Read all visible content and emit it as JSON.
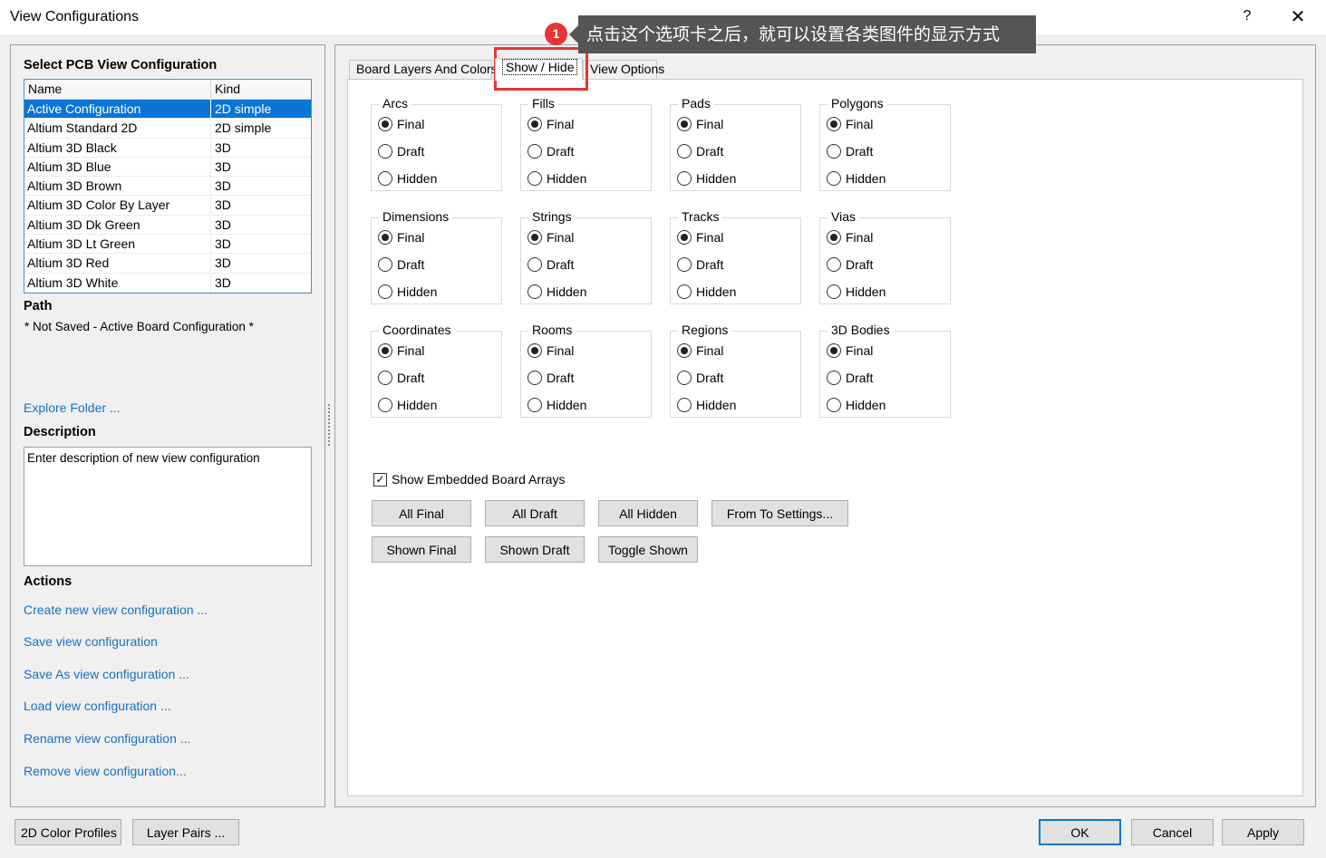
{
  "window": {
    "title": "View Configurations",
    "help": "?",
    "close": "✕"
  },
  "left": {
    "select_heading": "Select PCB View Configuration",
    "columns": [
      "Name",
      "Kind"
    ],
    "rows": [
      {
        "name": "Active Configuration",
        "kind": "2D simple"
      },
      {
        "name": "Altium Standard 2D",
        "kind": "2D simple"
      },
      {
        "name": "Altium 3D Black",
        "kind": "3D"
      },
      {
        "name": "Altium 3D Blue",
        "kind": "3D"
      },
      {
        "name": "Altium 3D Brown",
        "kind": "3D"
      },
      {
        "name": "Altium 3D Color By Layer",
        "kind": "3D"
      },
      {
        "name": "Altium 3D Dk Green",
        "kind": "3D"
      },
      {
        "name": "Altium 3D Lt Green",
        "kind": "3D"
      },
      {
        "name": "Altium 3D Red",
        "kind": "3D"
      },
      {
        "name": "Altium 3D White",
        "kind": "3D"
      }
    ],
    "path_heading": "Path",
    "path_value": "* Not Saved - Active Board Configuration *",
    "explore_folder": "Explore Folder ...",
    "description_heading": "Description",
    "description_value": "Enter description of new view configuration",
    "actions_heading": "Actions",
    "actions": [
      "Create new view configuration ...",
      "Save view configuration",
      "Save As view configuration ...",
      "Load view configuration ...",
      "Rename view configuration ...",
      "Remove view configuration..."
    ]
  },
  "tabs": [
    "Board Layers And Colors",
    "Show / Hide",
    "View Options"
  ],
  "groups": [
    {
      "title": "Arcs",
      "selected": "Final"
    },
    {
      "title": "Fills",
      "selected": "Final"
    },
    {
      "title": "Pads",
      "selected": "Final"
    },
    {
      "title": "Polygons",
      "selected": "Final"
    },
    {
      "title": "Dimensions",
      "selected": "Final"
    },
    {
      "title": "Strings",
      "selected": "Final"
    },
    {
      "title": "Tracks",
      "selected": "Final"
    },
    {
      "title": "Vias",
      "selected": "Final"
    },
    {
      "title": "Coordinates",
      "selected": "Final"
    },
    {
      "title": "Rooms",
      "selected": "Final"
    },
    {
      "title": "Regions",
      "selected": "Final"
    },
    {
      "title": "3D Bodies",
      "selected": "Final"
    }
  ],
  "radio_options": [
    "Final",
    "Draft",
    "Hidden"
  ],
  "embedded_checkbox": {
    "label": "Show Embedded Board Arrays",
    "checked": true
  },
  "buttons": {
    "all_final": "All Final",
    "all_draft": "All Draft",
    "all_hidden": "All Hidden",
    "from_to": "From To Settings...",
    "shown_final": "Shown Final",
    "shown_draft": "Shown Draft",
    "toggle_shown": "Toggle Shown"
  },
  "footer": {
    "color_profiles": "2D Color Profiles",
    "layer_pairs": "Layer Pairs ...",
    "ok": "OK",
    "cancel": "Cancel",
    "apply": "Apply"
  },
  "annotation": {
    "badge": "1",
    "tooltip": "点击这个选项卡之后，就可以设置各类图件的显示方式",
    "highlight_color": "#e53535",
    "tooltip_bg": "#555555"
  },
  "colors": {
    "selection": "#0a74d8",
    "link": "#1a6fc4"
  }
}
